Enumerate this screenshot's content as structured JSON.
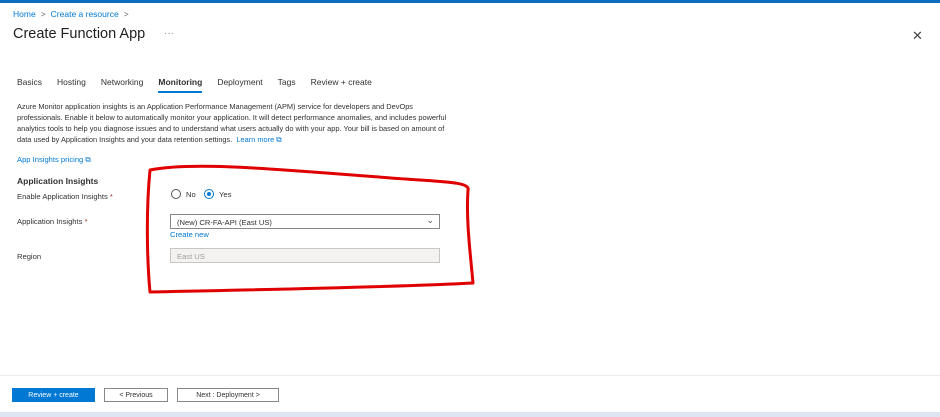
{
  "breadcrumb": [
    "Home",
    "Create a resource"
  ],
  "title": "Create Function App",
  "more": "···",
  "close": "✕",
  "tabs": [
    "Basics",
    "Hosting",
    "Networking",
    "Monitoring",
    "Deployment",
    "Tags",
    "Review + create"
  ],
  "active_tab": "Monitoring",
  "description": "Azure Monitor application insights is an Application Performance Management (APM) service for developers and DevOps professionals. Enable it below to automatically monitor your application. It will detect performance anomalies, and includes powerful analytics tools to help you diagnose issues and to understand what users actually do with your app. Your bill is based on amount of data used by Application Insights and your data retention settings.",
  "learn_more": "Learn more",
  "pricing_link": "App Insights pricing",
  "section": "Application Insights",
  "enable_label": "Enable Application Insights",
  "radio": {
    "no": "No",
    "yes": "Yes",
    "selected": "Yes"
  },
  "ai_label": "Application Insights",
  "ai_value": "(New) CR-FA-API (East US)",
  "create_new": "Create new",
  "region_label": "Region",
  "region_value": "East US",
  "buttons": {
    "review": "Review + create",
    "previous": "< Previous",
    "next": "Next : Deployment >"
  },
  "annotation_color": "#e00000"
}
